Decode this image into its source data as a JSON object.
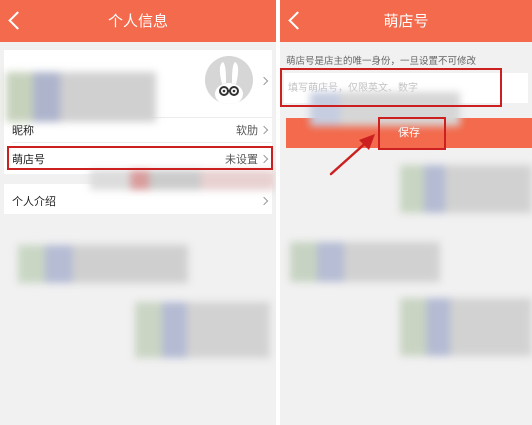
{
  "left": {
    "title": "个人信息",
    "rows": {
      "nickname_label": "昵称",
      "nickname_value": "软肋",
      "shop_id_label": "萌店号",
      "shop_id_value": "未设置",
      "intro_label": "个人介绍"
    }
  },
  "right": {
    "title": "萌店号",
    "notice": "萌店号是店主的唯一身份，一旦设置不可修改",
    "input_placeholder": "填写萌店号，仅限英文、数字",
    "save_label": "保存"
  },
  "colors": {
    "header": "#f36a4c",
    "highlight": "#cc1f1f",
    "background": "#f1f1f1"
  }
}
